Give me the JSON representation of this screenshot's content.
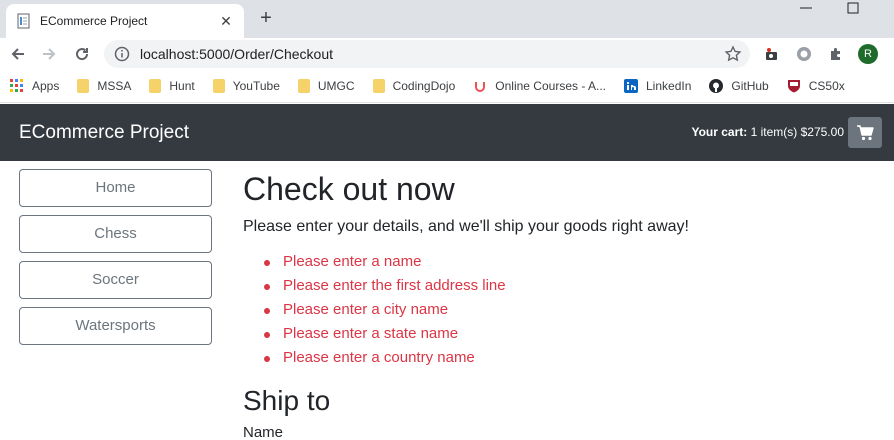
{
  "browser": {
    "tab_title": "ECommerce Project",
    "url": "localhost:5000/Order/Checkout",
    "profile_initial": "R",
    "bookmarks": [
      {
        "label": "Apps",
        "icon": "apps-grid-icon"
      },
      {
        "label": "MSSA",
        "icon": "folder-icon"
      },
      {
        "label": "Hunt",
        "icon": "folder-icon"
      },
      {
        "label": "YouTube",
        "icon": "folder-icon"
      },
      {
        "label": "UMGC",
        "icon": "folder-icon"
      },
      {
        "label": "CodingDojo",
        "icon": "folder-icon"
      },
      {
        "label": "Online Courses - A...",
        "icon": "udemy-icon"
      },
      {
        "label": "LinkedIn",
        "icon": "linkedin-icon"
      },
      {
        "label": "GitHub",
        "icon": "github-icon"
      },
      {
        "label": "CS50x",
        "icon": "harvard-shield-icon"
      }
    ]
  },
  "navbar": {
    "brand": "ECommerce Project",
    "cart_label": "Your cart:",
    "cart_value": "1 item(s) $275.00"
  },
  "sidebar": {
    "items": [
      "Home",
      "Chess",
      "Soccer",
      "Watersports"
    ]
  },
  "main": {
    "title": "Check out now",
    "lead": "Please enter your details, and we'll ship your goods right away!",
    "errors": [
      "Please enter a name",
      "Please enter the first address line",
      "Please enter a city name",
      "Please enter a state name",
      "Please enter a country name"
    ],
    "ship_to": "Ship to",
    "name_label": "Name"
  },
  "colors": {
    "navbar_bg": "#343a40",
    "error": "#dc3545",
    "secondary": "#6c757d"
  }
}
